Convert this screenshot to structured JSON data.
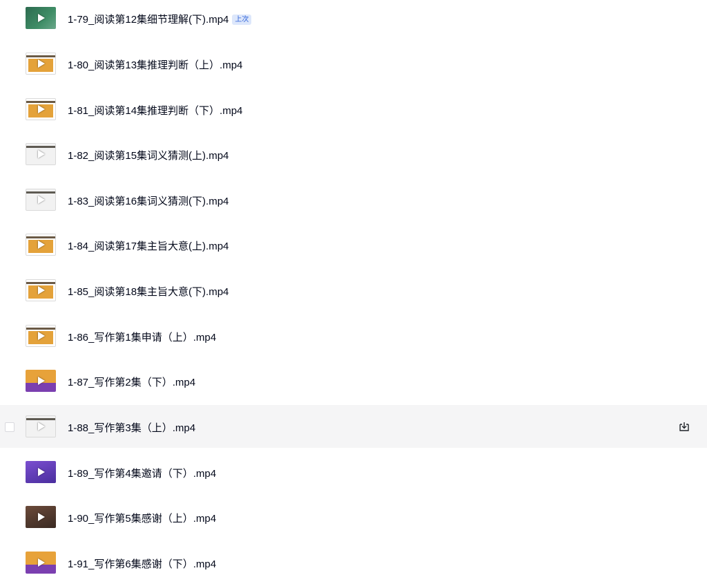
{
  "files": [
    {
      "name": "1-79_阅读第12集细节理解(下).mp4",
      "badge": "上次",
      "thumb": "board"
    },
    {
      "name": "1-80_阅读第13集推理判断（上）.mp4",
      "thumb": "orange"
    },
    {
      "name": "1-81_阅读第14集推理判断（下）.mp4",
      "thumb": "orange"
    },
    {
      "name": "1-82_阅读第15集词义猜测(上).mp4",
      "thumb": "white"
    },
    {
      "name": "1-83_阅读第16集词义猜测(下).mp4",
      "thumb": "white"
    },
    {
      "name": "1-84_阅读第17集主旨大意(上).mp4",
      "thumb": "orange"
    },
    {
      "name": "1-85_阅读第18集主旨大意(下).mp4",
      "thumb": "orange"
    },
    {
      "name": "1-86_写作第1集申请（上）.mp4",
      "thumb": "orange"
    },
    {
      "name": "1-87_写作第2集（下）.mp4",
      "thumb": "mix"
    },
    {
      "name": "1-88_写作第3集（上）.mp4",
      "thumb": "white",
      "hovered": true
    },
    {
      "name": "1-89_写作第4集邀请（下）.mp4",
      "thumb": "purple"
    },
    {
      "name": "1-90_写作第5集感谢（上）.mp4",
      "thumb": "dark"
    },
    {
      "name": "1-91_写作第6集感谢（下）.mp4",
      "thumb": "mix"
    }
  ],
  "icons": {
    "play": "play-icon",
    "download": "download-icon"
  },
  "colors": {
    "text": "#03081a",
    "badge_text": "#2f63d9",
    "badge_bg": "#dde7fb",
    "hover_bg": "#f5f5f6"
  }
}
